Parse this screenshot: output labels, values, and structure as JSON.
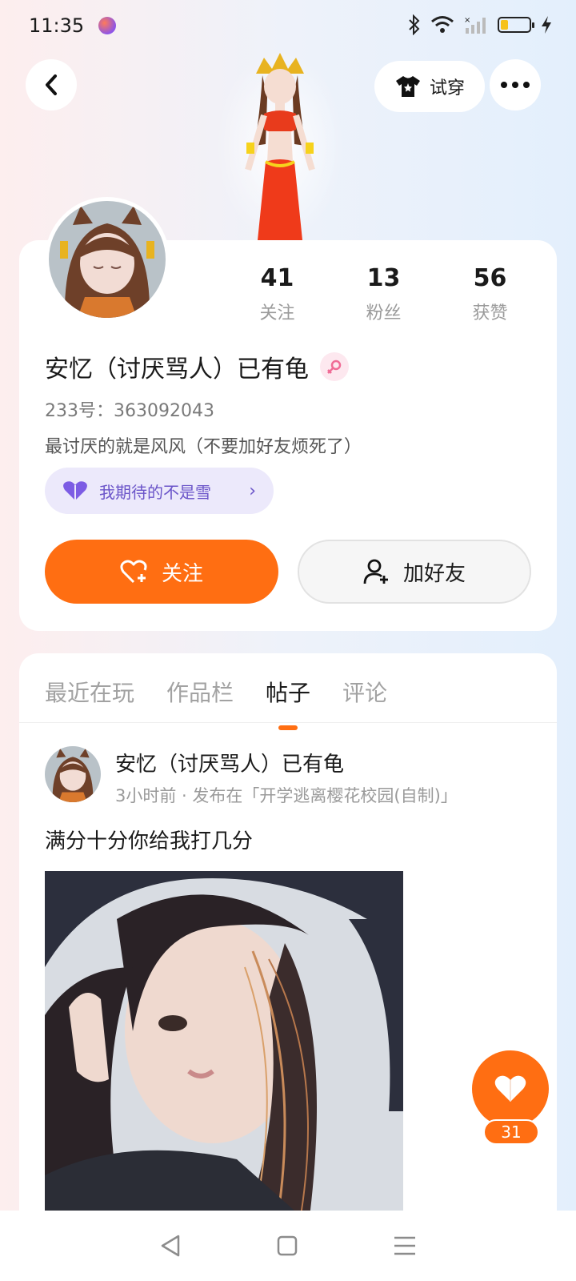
{
  "status_bar": {
    "time": "11:35",
    "battery_level": 0.25
  },
  "header": {
    "try_on_label": "试穿"
  },
  "profile": {
    "stats": [
      {
        "value": "41",
        "label": "关注"
      },
      {
        "value": "13",
        "label": "粉丝"
      },
      {
        "value": "56",
        "label": "获赞"
      }
    ],
    "username": "安忆（讨厌骂人）已有龟",
    "id_line": "233号：363092043",
    "bio": "最讨厌的就是风风（不要加好友烦死了）",
    "tag": "我期待的不是雪",
    "follow_label": "关注",
    "add_friend_label": "加好友"
  },
  "tabs": [
    "最近在玩",
    "作品栏",
    "帖子",
    "评论"
  ],
  "active_tab": "帖子",
  "post": {
    "author": "安忆（讨厌骂人）已有龟",
    "meta": "3小时前 · 发布在「开学逃离樱花校园(自制)」",
    "text": "满分十分你给我打几分",
    "like_count": "31"
  },
  "colors": {
    "accent": "#ff6e12",
    "tag_purple": "#6b55c9"
  }
}
